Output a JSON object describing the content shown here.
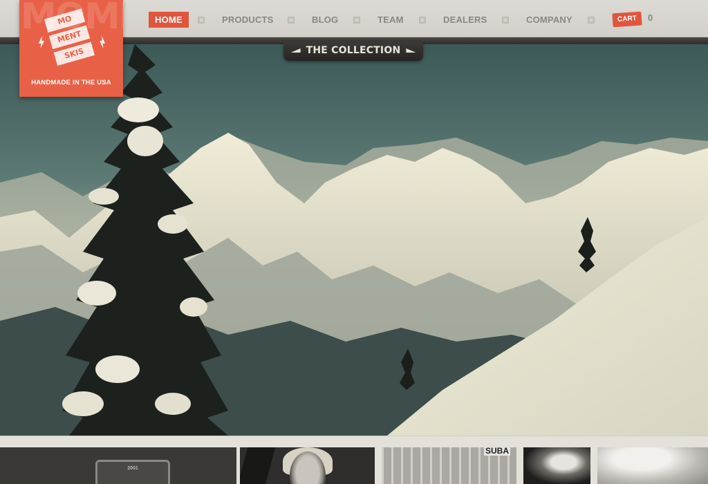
{
  "nav": {
    "items": [
      {
        "label": "HOME",
        "active": true
      },
      {
        "label": "PRODUCTS",
        "active": false
      },
      {
        "label": "BLOG",
        "active": false
      },
      {
        "label": "TEAM",
        "active": false
      },
      {
        "label": "DEALERS",
        "active": false
      },
      {
        "label": "COMPANY",
        "active": false
      }
    ],
    "cart_label": "CART",
    "cart_count": "0"
  },
  "logo": {
    "ghost_text": "MOMENT",
    "lines": [
      "MO",
      "MENT",
      "SKIS"
    ],
    "tagline": "HANDMADE IN THE USA"
  },
  "hero": {
    "tab_label": "THE COLLECTION"
  },
  "thumbnails": {
    "shield_text": "2001",
    "banner_text": "SUBA"
  },
  "colors": {
    "accent": "#e0553d",
    "logo": "#e86147",
    "nav_bg": "#d6d4cd",
    "nav_text": "#8a8780"
  }
}
